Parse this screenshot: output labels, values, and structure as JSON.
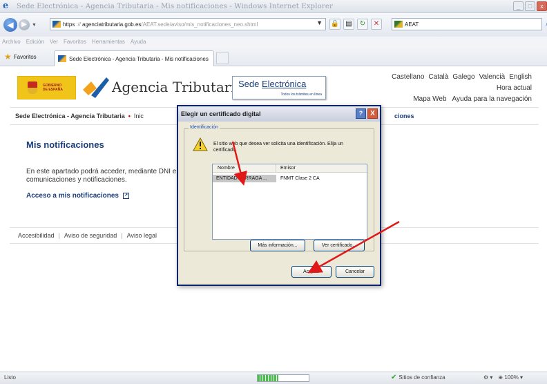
{
  "window": {
    "title": "Sede Electrónica - Agencia Tributaria - Mis notificaciones - Windows Internet Explorer",
    "controls": [
      "_",
      "□",
      "x"
    ]
  },
  "address_bar": {
    "protocol": "https",
    "domain": "agenciatributaria.gob.es",
    "path": "/AEAT.sede/aviso/mis_notificaciones_neo.shtml",
    "search_text": "AEAT",
    "search_icon": "search-icon"
  },
  "menu": [
    "Archivo",
    "Edición",
    "Ver",
    "Favoritos",
    "Herramientas",
    "Ayuda"
  ],
  "favorites_label": "Favoritos",
  "tab": {
    "label": "Sede Electrónica - Agencia Tributaria - Mis notificaciones"
  },
  "header": {
    "gob_text_1": "GOBIERNO",
    "gob_text_2": "DE ESPAÑA",
    "agency_name": "Agencia Tributaria",
    "sede_title_1": "Sede ",
    "sede_title_2": "Electrónica",
    "sede_tagline": "Todos los trámites en línea",
    "languages": [
      "Castellano",
      "Català",
      "Galego",
      "Valencià",
      "English"
    ],
    "hora_actual": "Hora actual",
    "mapa_web": "Mapa Web",
    "ayuda_nav": "Ayuda para la navegación"
  },
  "breadcrumb": {
    "root": "Sede Electrónica - Agencia Tributaria",
    "separator": "•",
    "current": "Inic",
    "tail": "ciones"
  },
  "main": {
    "heading": "Mis notificaciones",
    "paragraph": "En este apartado podrá acceder, mediante DNI e comunicaciones y notificaciones.",
    "access_link": "Acceso a mis notificaciones"
  },
  "footer": {
    "links": [
      "Accesibilidad",
      "Aviso de seguridad",
      "Aviso legal"
    ]
  },
  "dialog": {
    "title": "Elegir un certificado digital",
    "help": "?",
    "close": "X",
    "group_label": "Identificación",
    "message": "El sitio web que desea ver solicita una identificación. Elija un certificado.",
    "columns": [
      "Nombre",
      "Emisor"
    ],
    "rows": [
      {
        "name": "ENTIDAD PARRAGA ...",
        "issuer": "FNMT Clase 2 CA"
      }
    ],
    "more_info_button": "Más información...",
    "view_cert_button": "Ver certificado...",
    "ok_button": "Aceptar",
    "cancel_button": "Cancelar"
  },
  "status_bar": {
    "status": "Listo",
    "progress": 0.4,
    "trust_zone": "Sitios de confianza",
    "zoom": "100%"
  },
  "colors": {
    "link_blue": "#1a3d7a",
    "annotation_red": "#e01818",
    "dialog_border": "#0a246a"
  }
}
